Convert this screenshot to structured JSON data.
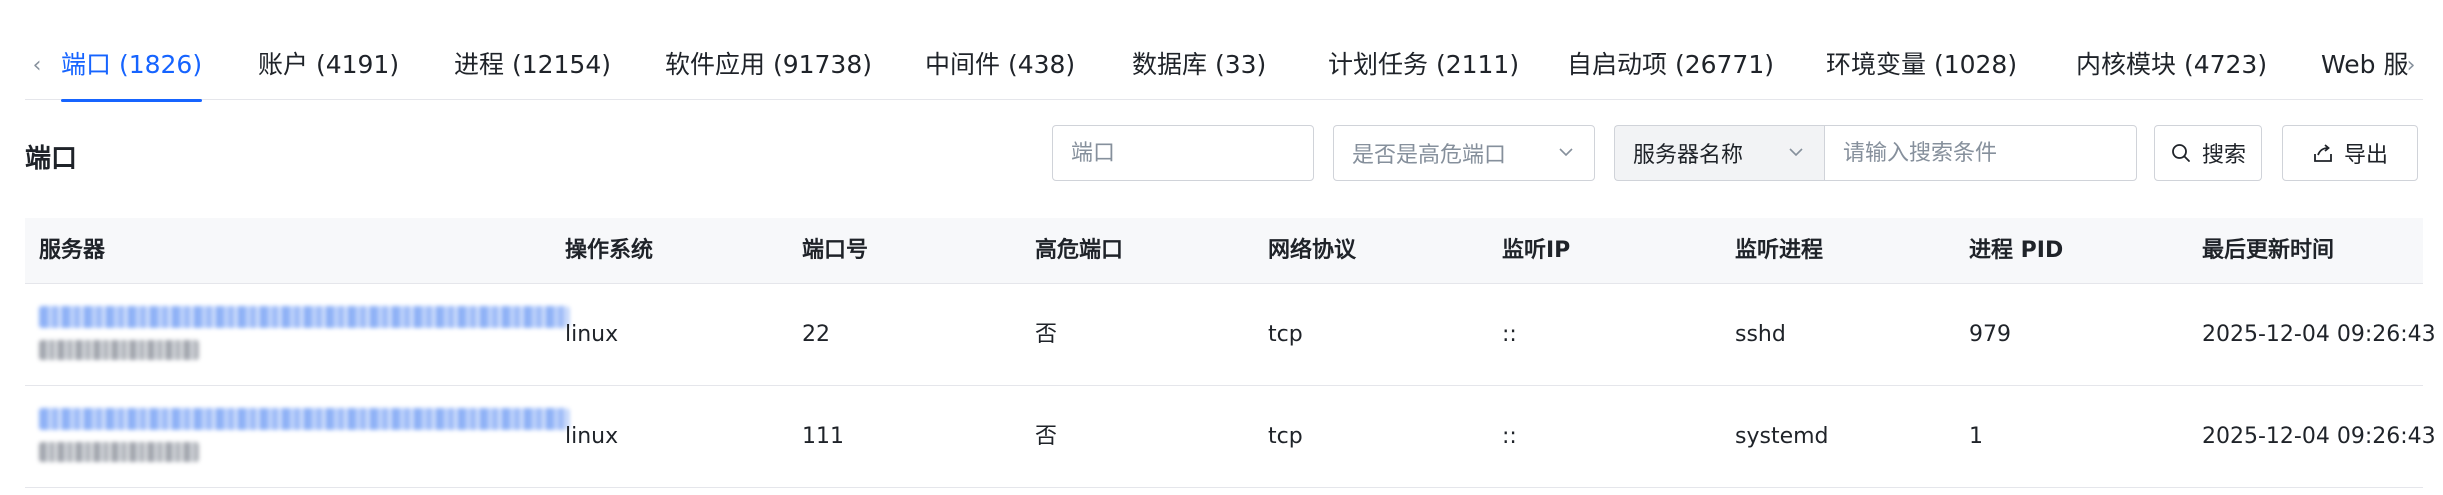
{
  "tabs": {
    "items": [
      {
        "label": "端口 (1826)",
        "active": true
      },
      {
        "label": "账户 (4191)",
        "active": false
      },
      {
        "label": "进程 (12154)",
        "active": false
      },
      {
        "label": "软件应用 (91738)",
        "active": false
      },
      {
        "label": "中间件 (438)",
        "active": false
      },
      {
        "label": "数据库 (33)",
        "active": false
      },
      {
        "label": "计划任务 (2111)",
        "active": false
      },
      {
        "label": "自启动项 (26771)",
        "active": false
      },
      {
        "label": "环境变量 (1028)",
        "active": false
      },
      {
        "label": "内核模块 (4723)",
        "active": false
      },
      {
        "label": "Web 服",
        "active": false
      }
    ]
  },
  "toolbar": {
    "title": "端口",
    "port_placeholder": "端口",
    "high_risk_placeholder": "是否是高危端口",
    "field_select": "服务器名称",
    "search_placeholder": "请输入搜索条件",
    "search_label": "搜索",
    "export_label": "导出"
  },
  "table": {
    "columns": [
      "服务器",
      "操作系统",
      "端口号",
      "高危端口",
      "网络协议",
      "监听IP",
      "监听进程",
      "进程 PID",
      "最后更新时间"
    ],
    "rows": [
      {
        "os": "linux",
        "port": "22",
        "high_risk": "否",
        "protocol": "tcp",
        "listen_ip": "::",
        "process": "sshd",
        "pid": "979",
        "updated": "2025-12-04 09:26:43"
      },
      {
        "os": "linux",
        "port": "111",
        "high_risk": "否",
        "protocol": "tcp",
        "listen_ip": "::",
        "process": "systemd",
        "pid": "1",
        "updated": "2025-12-04 09:26:43"
      }
    ]
  },
  "colors": {
    "accent": "#1664ff",
    "border": "#d0d3d9",
    "header_bg": "#f7f8fa"
  }
}
